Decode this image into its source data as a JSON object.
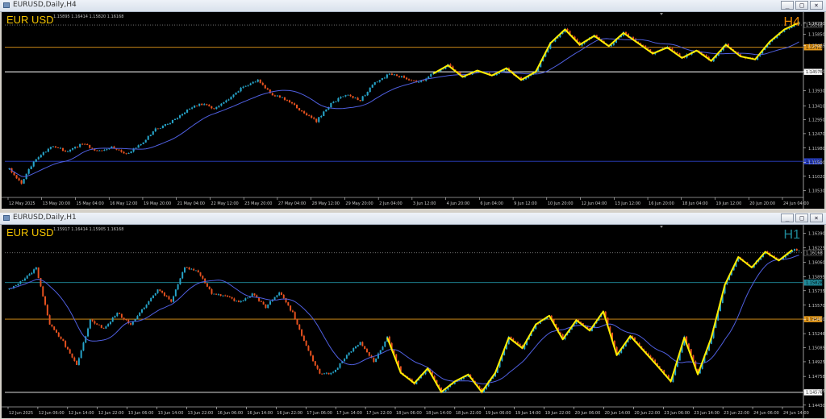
{
  "colors": {
    "background": "#000000",
    "bull": "#26a4c9",
    "bear": "#e8521f",
    "ma": "#4f5fe0",
    "zigzag": "#ffee00",
    "level_orange": "#e79a1a",
    "level_white": "#ffffff",
    "level_blue": "#2c43c9",
    "axis_text": "#c8c8c8"
  },
  "windows": [
    {
      "title": "EURUSD,Daily,H4",
      "controls": [
        "_",
        "□",
        "×"
      ]
    },
    {
      "title": "EURUSD,Daily,H1",
      "controls": [
        "_",
        "□",
        "×"
      ]
    }
  ],
  "chart_data": [
    {
      "type": "candlestick",
      "symbol_label": "EUR USD",
      "timeframe_label": "H4",
      "timeframe_color": "#f08a00",
      "ohlc_text": "1.15895 1.16414 1.15820 1.16168",
      "price_ticks": [
        "1.16230",
        "1.15850",
        "1.15465",
        "1.14600",
        "1.13930",
        "1.13410",
        "1.12950",
        "1.12470",
        "1.11980",
        "1.11500",
        "1.11020",
        "1.10530"
      ],
      "ylim": [
        1.103,
        1.165
      ],
      "time_ticks": [
        "12 May 2025",
        "13 May 20:00",
        "15 May 04:00",
        "16 May 12:00",
        "19 May 20:00",
        "21 May 04:00",
        "22 May 12:00",
        "23 May 20:00",
        "27 May 04:00",
        "28 May 12:00",
        "29 May 20:00",
        "2 Jun 04:00",
        "3 Jun 12:00",
        "4 Jun 20:00",
        "6 Jun 04:00",
        "9 Jun 12:00",
        "10 Jun 20:00",
        "12 Jun 04:00",
        "13 Jun 12:00",
        "16 Jun 20:00",
        "18 Jun 04:00",
        "19 Jun 12:00",
        "20 Jun 20:00",
        "24 Jun 04:00"
      ],
      "levels": [
        {
          "price": 1.16168,
          "label": "1.16168",
          "color": "#808080",
          "style": "dotted"
        },
        {
          "price": 1.15411,
          "label": "1.15411",
          "color": "#e79a1a",
          "style": "solid"
        },
        {
          "price": 1.14576,
          "label": "1.14576",
          "color": "#ffffff",
          "style": "solid"
        },
        {
          "price": 1.11529,
          "label": "1.11529",
          "color": "#2c43c9",
          "style": "solid"
        }
      ],
      "close_anchors": [
        [
          0,
          1.1128
        ],
        [
          5,
          1.1075
        ],
        [
          10,
          1.1155
        ],
        [
          18,
          1.1205
        ],
        [
          24,
          1.1185
        ],
        [
          30,
          1.1215
        ],
        [
          36,
          1.1188
        ],
        [
          42,
          1.1202
        ],
        [
          48,
          1.1178
        ],
        [
          54,
          1.121
        ],
        [
          60,
          1.1262
        ],
        [
          66,
          1.1285
        ],
        [
          72,
          1.1322
        ],
        [
          78,
          1.135
        ],
        [
          84,
          1.1333
        ],
        [
          90,
          1.1362
        ],
        [
          96,
          1.1408
        ],
        [
          102,
          1.1428
        ],
        [
          108,
          1.138
        ],
        [
          114,
          1.1362
        ],
        [
          120,
          1.1322
        ],
        [
          126,
          1.129
        ],
        [
          132,
          1.135
        ],
        [
          138,
          1.138
        ],
        [
          144,
          1.1362
        ],
        [
          150,
          1.142
        ],
        [
          156,
          1.145
        ],
        [
          162,
          1.1438
        ],
        [
          168,
          1.142
        ],
        [
          174,
          1.1452
        ],
        [
          180,
          1.148
        ],
        [
          186,
          1.144
        ],
        [
          192,
          1.1462
        ],
        [
          198,
          1.1445
        ],
        [
          204,
          1.147
        ],
        [
          210,
          1.143
        ],
        [
          216,
          1.1458
        ],
        [
          222,
          1.1555
        ],
        [
          228,
          1.1602
        ],
        [
          234,
          1.155
        ],
        [
          240,
          1.158
        ],
        [
          246,
          1.1545
        ],
        [
          252,
          1.159
        ],
        [
          258,
          1.1555
        ],
        [
          264,
          1.152
        ],
        [
          270,
          1.154
        ],
        [
          276,
          1.1505
        ],
        [
          282,
          1.153
        ],
        [
          288,
          1.1495
        ],
        [
          294,
          1.155
        ],
        [
          300,
          1.151
        ],
        [
          306,
          1.15
        ],
        [
          312,
          1.156
        ],
        [
          318,
          1.1602
        ],
        [
          324,
          1.1625
        ]
      ],
      "n_bars": 325,
      "zigzag_start": 170,
      "ma_period": 24
    },
    {
      "type": "candlestick",
      "symbol_label": "EUR USD",
      "timeframe_label": "H1",
      "timeframe_color": "#1f8a9a",
      "ohlc_text": "1.15917 1.16414 1.15905 1.16168",
      "price_ticks": [
        "1.16390",
        "1.16225",
        "1.16060",
        "1.15895",
        "1.15735",
        "1.15570",
        "1.15410",
        "1.15246",
        "1.15085",
        "1.14925",
        "1.14758",
        "1.14595",
        "1.14430"
      ],
      "ylim": [
        1.1441,
        1.1645
      ],
      "time_ticks": [
        "12 Jun 2025",
        "12 Jun 06:00",
        "12 Jun 14:00",
        "12 Jun 22:00",
        "13 Jun 06:00",
        "13 Jun 14:00",
        "13 Jun 22:00",
        "16 Jun 06:00",
        "16 Jun 14:00",
        "16 Jun 22:00",
        "17 Jun 06:00",
        "17 Jun 14:00",
        "17 Jun 22:00",
        "18 Jun 06:00",
        "18 Jun 14:00",
        "18 Jun 22:00",
        "19 Jun 06:00",
        "19 Jun 14:00",
        "19 Jun 22:00",
        "20 Jun 06:00",
        "20 Jun 14:00",
        "20 Jun 22:00",
        "23 Jun 06:00",
        "23 Jun 14:00",
        "23 Jun 22:00",
        "24 Jun 06:00",
        "24 Jun 14:00"
      ],
      "levels": [
        {
          "price": 1.16168,
          "label": "1.16168",
          "color": "#808080",
          "style": "dotted"
        },
        {
          "price": 1.15828,
          "label": "1.15828",
          "color": "#1f8a9a",
          "style": "solid"
        },
        {
          "price": 1.15411,
          "label": "1.15411",
          "color": "#e79a1a",
          "style": "solid"
        },
        {
          "price": 1.14576,
          "label": "1.14576",
          "color": "#ffffff",
          "style": "solid"
        }
      ],
      "close_anchors": [
        [
          0,
          1.1575
        ],
        [
          6,
          1.1585
        ],
        [
          12,
          1.16
        ],
        [
          18,
          1.1535
        ],
        [
          24,
          1.1515
        ],
        [
          30,
          1.1488
        ],
        [
          36,
          1.154
        ],
        [
          42,
          1.153
        ],
        [
          48,
          1.1548
        ],
        [
          54,
          1.1535
        ],
        [
          60,
          1.1555
        ],
        [
          66,
          1.1575
        ],
        [
          72,
          1.1562
        ],
        [
          78,
          1.16
        ],
        [
          84,
          1.1595
        ],
        [
          90,
          1.157
        ],
        [
          96,
          1.1568
        ],
        [
          102,
          1.156
        ],
        [
          108,
          1.157
        ],
        [
          114,
          1.1555
        ],
        [
          120,
          1.1572
        ],
        [
          126,
          1.1548
        ],
        [
          132,
          1.151
        ],
        [
          138,
          1.1478
        ],
        [
          144,
          1.148
        ],
        [
          150,
          1.15
        ],
        [
          156,
          1.1515
        ],
        [
          162,
          1.1492
        ],
        [
          168,
          1.152
        ],
        [
          174,
          1.148
        ],
        [
          180,
          1.1468
        ],
        [
          186,
          1.1485
        ],
        [
          192,
          1.1458
        ],
        [
          198,
          1.147
        ],
        [
          204,
          1.1478
        ],
        [
          210,
          1.1458
        ],
        [
          216,
          1.148
        ],
        [
          222,
          1.152
        ],
        [
          228,
          1.1508
        ],
        [
          234,
          1.1535
        ],
        [
          240,
          1.1545
        ],
        [
          246,
          1.1518
        ],
        [
          252,
          1.154
        ],
        [
          258,
          1.1528
        ],
        [
          264,
          1.155
        ],
        [
          270,
          1.15
        ],
        [
          276,
          1.1522
        ],
        [
          282,
          1.1505
        ],
        [
          288,
          1.1488
        ],
        [
          294,
          1.147
        ],
        [
          300,
          1.152
        ],
        [
          306,
          1.1478
        ],
        [
          312,
          1.152
        ],
        [
          318,
          1.158
        ],
        [
          324,
          1.1612
        ],
        [
          330,
          1.16
        ],
        [
          336,
          1.1618
        ],
        [
          342,
          1.1608
        ],
        [
          348,
          1.162
        ]
      ],
      "n_bars": 352,
      "zigzag_start": 168,
      "ma_period": 20
    }
  ]
}
